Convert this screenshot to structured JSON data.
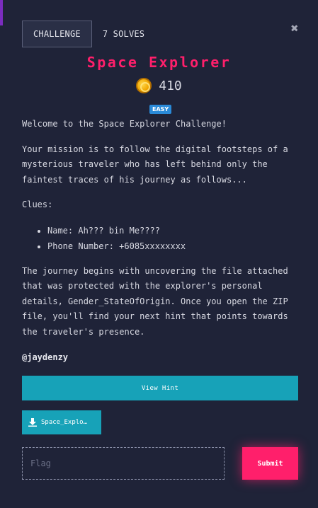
{
  "tabs": [
    {
      "label": "CHALLENGE"
    },
    {
      "label": "7 SOLVES"
    }
  ],
  "close_icon": "close-icon",
  "challenge": {
    "title": "Space Explorer",
    "points": "410",
    "difficulty": "EASY"
  },
  "description": {
    "intro": "Welcome to the Space Explorer Challenge!",
    "mission": "Your mission is to follow the digital footsteps of a mysterious traveler who has left behind only the faintest traces of his journey as follows...",
    "clues_heading": "Clues:",
    "clues": [
      "Name: Ah??? bin Me????",
      "Phone Number: +6085xxxxxxxx"
    ],
    "journey": "The journey begins with uncovering the file attached that was protected with the explorer's personal details, Gender_StateOfOrigin. Once you open the ZIP file, you'll find your next hint that points towards the traveler's presence."
  },
  "author": "@jaydenzy",
  "hint_button": "View Hint",
  "file_button": "Space_Explo…",
  "flag_placeholder": "Flag",
  "submit_label": "Submit",
  "colors": {
    "background": "#1f2338",
    "accent": "#ff1f6b",
    "teal": "#17a2b8",
    "badge": "#2a8ad8"
  }
}
